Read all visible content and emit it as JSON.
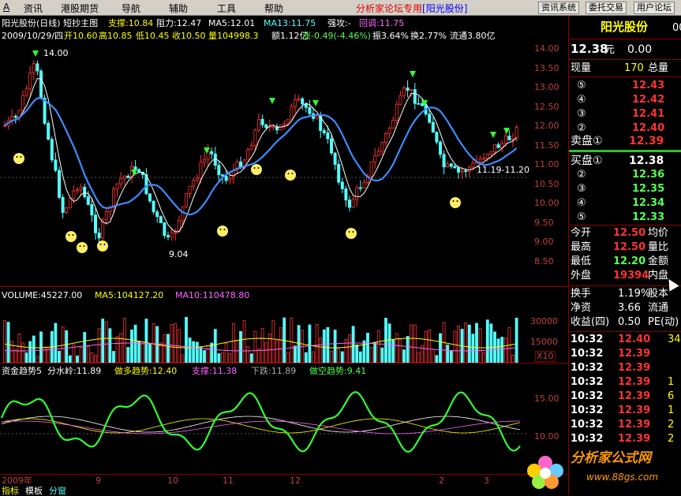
{
  "menu": {
    "items": [
      "资讯",
      "港股期货",
      "导航",
      "辅助",
      "工具",
      "帮助"
    ],
    "forum_label": "分析家论坛专用",
    "forum_stock": "[阳光股份]",
    "buttons": [
      "资讯系统",
      "委托交易",
      "用户论坛"
    ]
  },
  "chart_header": {
    "name": "阳光股份(日线) 短抄主图",
    "support": "支撑:10.84",
    "resist": "阻力:12.47",
    "ma5": "MA5:12.01",
    "ma13": "MA13:11.75",
    "strong": "强攻:-",
    "pullback": "回调:11.75",
    "date": "2009/10/29/四",
    "open": "开10.60",
    "high": "高10.85",
    "low": "低10.45",
    "close": "收10.50",
    "vol": "量104998.3",
    "amt": "额1.12亿",
    "change": "涨-0.49(-4.46%)",
    "amp": "振3.64%",
    "turnover": "换2.77%",
    "float": "流通3.80亿"
  },
  "price_axis": [
    "14.00",
    "13.50",
    "13.00",
    "12.50",
    "12.00",
    "11.50",
    "11.00",
    "10.50",
    "10.00",
    "9.50",
    "9.00",
    "8.50"
  ],
  "annotations": {
    "high": "14.00",
    "low": "9.04",
    "range": "11.19-11.20"
  },
  "volume": {
    "vol": "VOLUME:45227.00",
    "ma5": "MA5:104127.20",
    "ma10": "MA10:110478.80",
    "axis": [
      "30000",
      "15000"
    ],
    "scale": "X10"
  },
  "indicator": {
    "name": "资金趋势5",
    "line1": "分水岭:11.89",
    "line2": "做多趋势:12.40",
    "line3": "支撑:11.38",
    "line4": "下跌:11.89",
    "line5": "做空趋势:9.41",
    "axis": [
      "15.00",
      "10.00"
    ]
  },
  "time_axis": [
    "2009年",
    "9",
    "10",
    "11",
    "12",
    "2",
    "3"
  ],
  "bottom_tabs": [
    "指标",
    "模板",
    "分窗"
  ],
  "quote": {
    "title": "阳光股份",
    "code": "00",
    "price": "12.38",
    "price_unit": "元",
    "change": "0.00",
    "xianliang_label": "现量",
    "xianliang": "170",
    "zongliang_label": "总量",
    "sell": [
      {
        "n": "⑤",
        "p": "12.43"
      },
      {
        "n": "④",
        "p": "12.42"
      },
      {
        "n": "③",
        "p": "12.41"
      },
      {
        "n": "②",
        "p": "12.40"
      }
    ],
    "sell1_label": "卖盘①",
    "sell1": "12.39",
    "buy1_label": "买盘①",
    "buy1": "12.38",
    "buy": [
      {
        "n": "②",
        "p": "12.36"
      },
      {
        "n": "③",
        "p": "12.35"
      },
      {
        "n": "④",
        "p": "12.34"
      },
      {
        "n": "⑤",
        "p": "12.33"
      }
    ],
    "stats": [
      {
        "l": "今开",
        "v": "12.50",
        "l2": "均价"
      },
      {
        "l": "最高",
        "v": "12.50",
        "l2": "量比"
      },
      {
        "l": "最低",
        "v": "12.20",
        "l2": "金额"
      },
      {
        "l": "外盘",
        "v": "19394",
        "l2": "内盘"
      }
    ],
    "stats2": [
      {
        "l": "换手",
        "v": "1.19%",
        "l2": "股本"
      },
      {
        "l": "净资",
        "v": "3.66",
        "l2": "流通"
      },
      {
        "l": "收益(四)",
        "v": "0.50",
        "l2": "PE(动)"
      }
    ],
    "ticks": [
      {
        "t": "10:32",
        "p": "12.40",
        "v": "34"
      },
      {
        "t": "10:32",
        "p": "12.39",
        "v": ""
      },
      {
        "t": "10:32",
        "p": "12.39",
        "v": ""
      },
      {
        "t": "10:32",
        "p": "12.39",
        "v": "1"
      },
      {
        "t": "10:32",
        "p": "12.39",
        "v": "6"
      },
      {
        "t": "10:32",
        "p": "12.39",
        "v": "1"
      },
      {
        "t": "10:32",
        "p": "12.39",
        "v": "2"
      },
      {
        "t": "10:32",
        "p": "12.39",
        "v": "2"
      }
    ]
  },
  "watermark": {
    "name": "分析家公式网",
    "url": "www.88gs.com"
  },
  "colors": {
    "up": "#ff3333",
    "down": "#54ffff",
    "ma13": "#3c8cff",
    "bg": "#000000",
    "panel_line": "#8b0000"
  }
}
